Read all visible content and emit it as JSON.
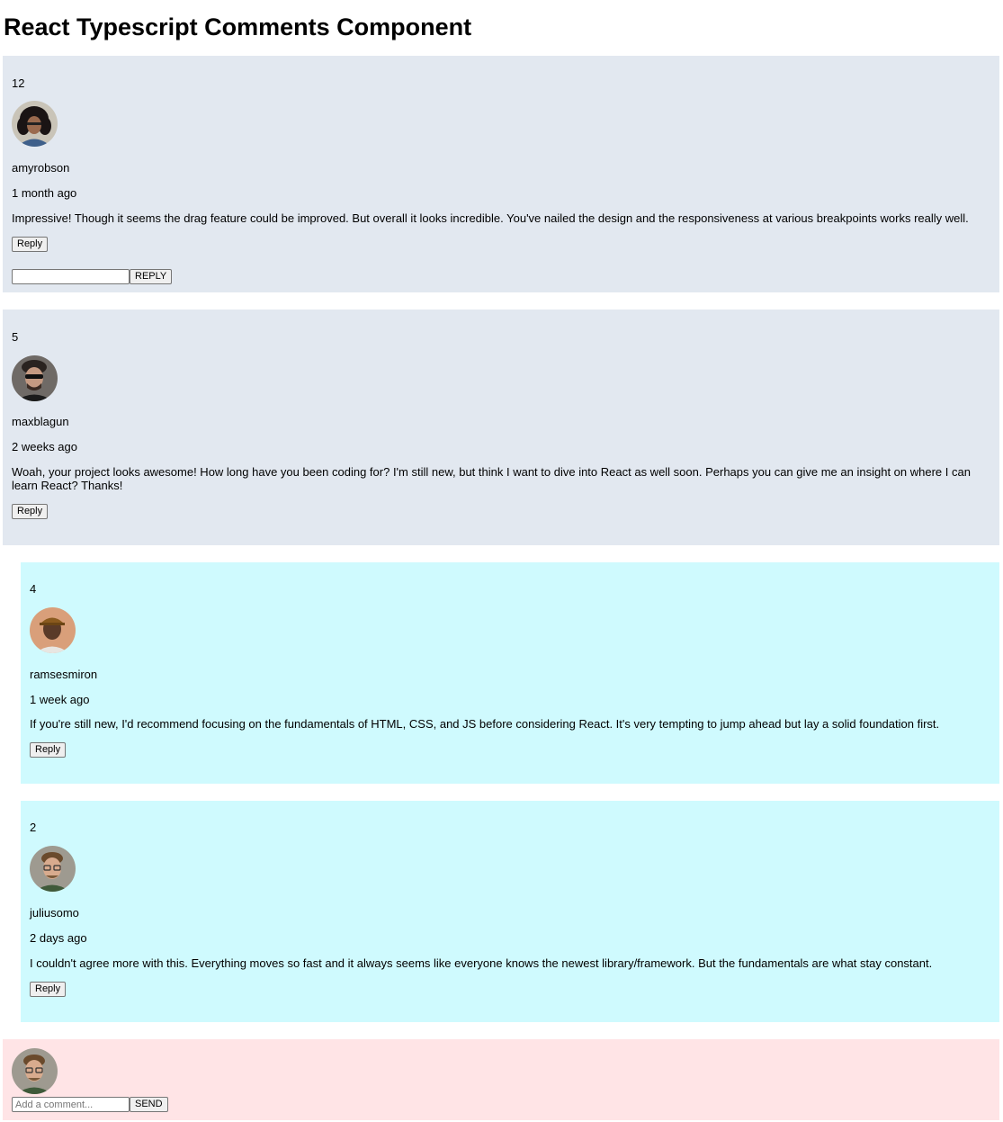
{
  "page": {
    "title": "React Typescript Comments Component"
  },
  "comments": [
    {
      "score": "12",
      "username": "amyrobson",
      "created": "1 month ago",
      "content": "Impressive! Though it seems the drag feature could be improved. But overall it looks incredible. You've nailed the design and the responsiveness at various breakpoints works really well.",
      "reply_label": "Reply",
      "reply_form": {
        "value": "",
        "submit_label": "REPLY"
      }
    },
    {
      "score": "5",
      "username": "maxblagun",
      "created": "2 weeks ago",
      "content": "Woah, your project looks awesome! How long have you been coding for? I'm still new, but think I want to dive into React as well soon. Perhaps you can give me an insight on where I can learn React? Thanks!",
      "reply_label": "Reply",
      "replies": [
        {
          "score": "4",
          "username": "ramsesmiron",
          "created": "1 week ago",
          "content": "If you're still new, I'd recommend focusing on the fundamentals of HTML, CSS, and JS before considering React. It's very tempting to jump ahead but lay a solid foundation first.",
          "reply_label": "Reply"
        },
        {
          "score": "2",
          "username": "juliusomo",
          "created": "2 days ago",
          "content": "I couldn't agree more with this. Everything moves so fast and it always seems like everyone knows the newest library/framework. But the fundamentals are what stay constant.",
          "reply_label": "Reply"
        }
      ]
    }
  ],
  "composer": {
    "placeholder": "Add a comment...",
    "send_label": "SEND"
  }
}
